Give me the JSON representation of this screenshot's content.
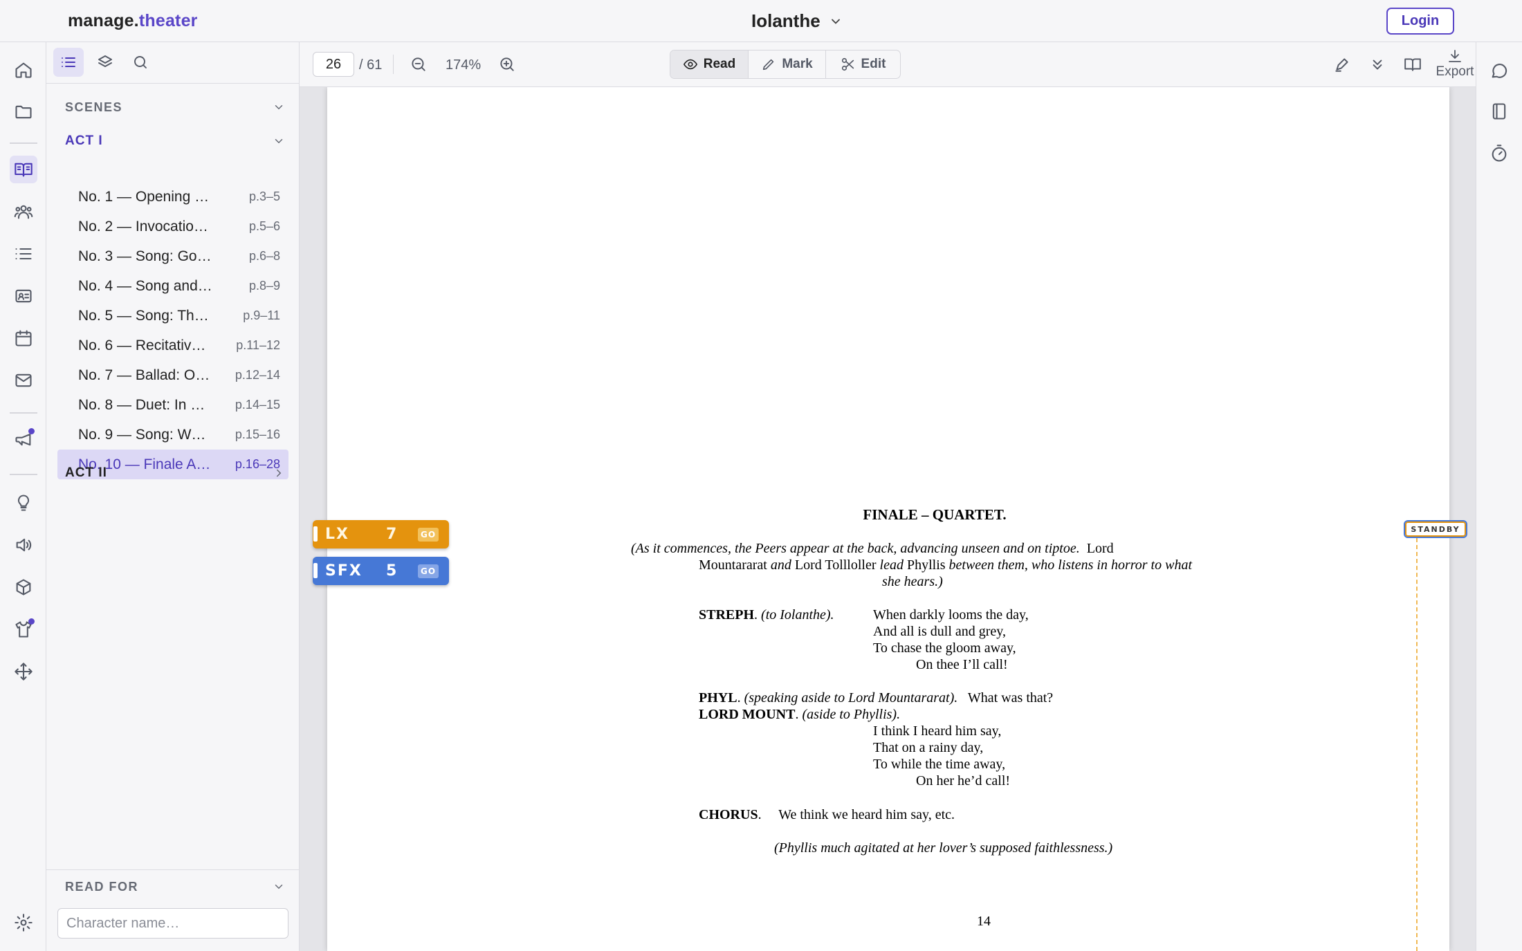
{
  "header": {
    "brand_part1": "manage.",
    "brand_part2": "theater",
    "doc_title": "Iolanthe",
    "login_label": "Login"
  },
  "rail": {
    "icons": [
      "home-icon",
      "folder-icon",
      "book-open-icon",
      "users-icon",
      "list-icon",
      "id-card-icon",
      "calendar-icon",
      "mail-icon",
      "megaphone-icon",
      "lightbulb-icon",
      "speaker-icon",
      "box-icon",
      "shirt-icon",
      "move-icon",
      "gear-icon"
    ]
  },
  "sidebar": {
    "scenes_label": "SCENES",
    "acts": [
      {
        "label": "ACT I",
        "expanded": true,
        "scenes": [
          {
            "label": "No. 1 — Opening …",
            "pages": "p.3–5"
          },
          {
            "label": "No. 2 — Invocatio…",
            "pages": "p.5–6"
          },
          {
            "label": "No. 3 — Song: Go…",
            "pages": "p.6–8"
          },
          {
            "label": "No. 4 — Song and…",
            "pages": "p.8–9"
          },
          {
            "label": "No. 5 — Song: Th…",
            "pages": "p.9–11"
          },
          {
            "label": "No. 6 — Recitativ…",
            "pages": "p.11–12"
          },
          {
            "label": "No. 7 — Ballad: O…",
            "pages": "p.12–14"
          },
          {
            "label": "No. 8 — Duet: In …",
            "pages": "p.14–15"
          },
          {
            "label": "No. 9 — Song: W…",
            "pages": "p.15–16"
          },
          {
            "label": "No. 10 — Finale A…",
            "pages": "p.16–28",
            "selected": true
          }
        ]
      },
      {
        "label": "ACT II",
        "expanded": false
      }
    ],
    "read_for_label": "READ FOR",
    "character_placeholder": "Character name…"
  },
  "toolbar": {
    "page_current": "26",
    "page_total": "/ 61",
    "zoom": "174%",
    "modes": [
      {
        "label": "Read",
        "icon": "eye-icon",
        "active": true
      },
      {
        "label": "Mark",
        "icon": "pencil-icon",
        "active": false
      },
      {
        "label": "Edit",
        "icon": "scissors-icon",
        "active": false
      }
    ],
    "export_label": "Export"
  },
  "cues": [
    {
      "type": "LX",
      "number": "7",
      "go": "GO",
      "color": "#e4930e"
    },
    {
      "type": "SFX",
      "number": "5",
      "go": "GO",
      "color": "#4678d6"
    }
  ],
  "standby_label": "STANDBY",
  "script": {
    "heading": "FINALE – QUARTET.",
    "dir1_a": "(As it commences, the Peers appear at the back, advancing unseen and on tiptoe.",
    "dir1_b": "Lord",
    "dir1_c": "Mountararat",
    "dir1_d": "and",
    "dir1_e": "Lord Tollloller",
    "dir1_f": "lead",
    "dir1_g": "Phyllis",
    "dir1_h": "between them, who listens in horror to what",
    "dir1_i": "she hears.)",
    "streph_name": "STREPH",
    "streph_dir": "(to Iolanthe).",
    "streph_lines": [
      "When darkly looms the day,",
      "And all is dull and grey,",
      "To chase the gloom away,",
      "On thee I’ll call!"
    ],
    "phyl_name": "PHYL",
    "phyl_dir": "(speaking aside to Lord Mountararat).",
    "phyl_line": "What was that?",
    "mount_name": "LORD MOUNT",
    "mount_dir": "(aside to Phyllis).",
    "mount_lines": [
      "I think I heard him say,",
      "That on a rainy day,",
      "To while the time away,",
      "On her he’d call!"
    ],
    "chorus_name": "CHORUS",
    "chorus_line": "We think we heard him say, etc.",
    "dir2": "(Phyllis much agitated at her lover’s supposed faithlessness.)",
    "page_number": "14"
  }
}
